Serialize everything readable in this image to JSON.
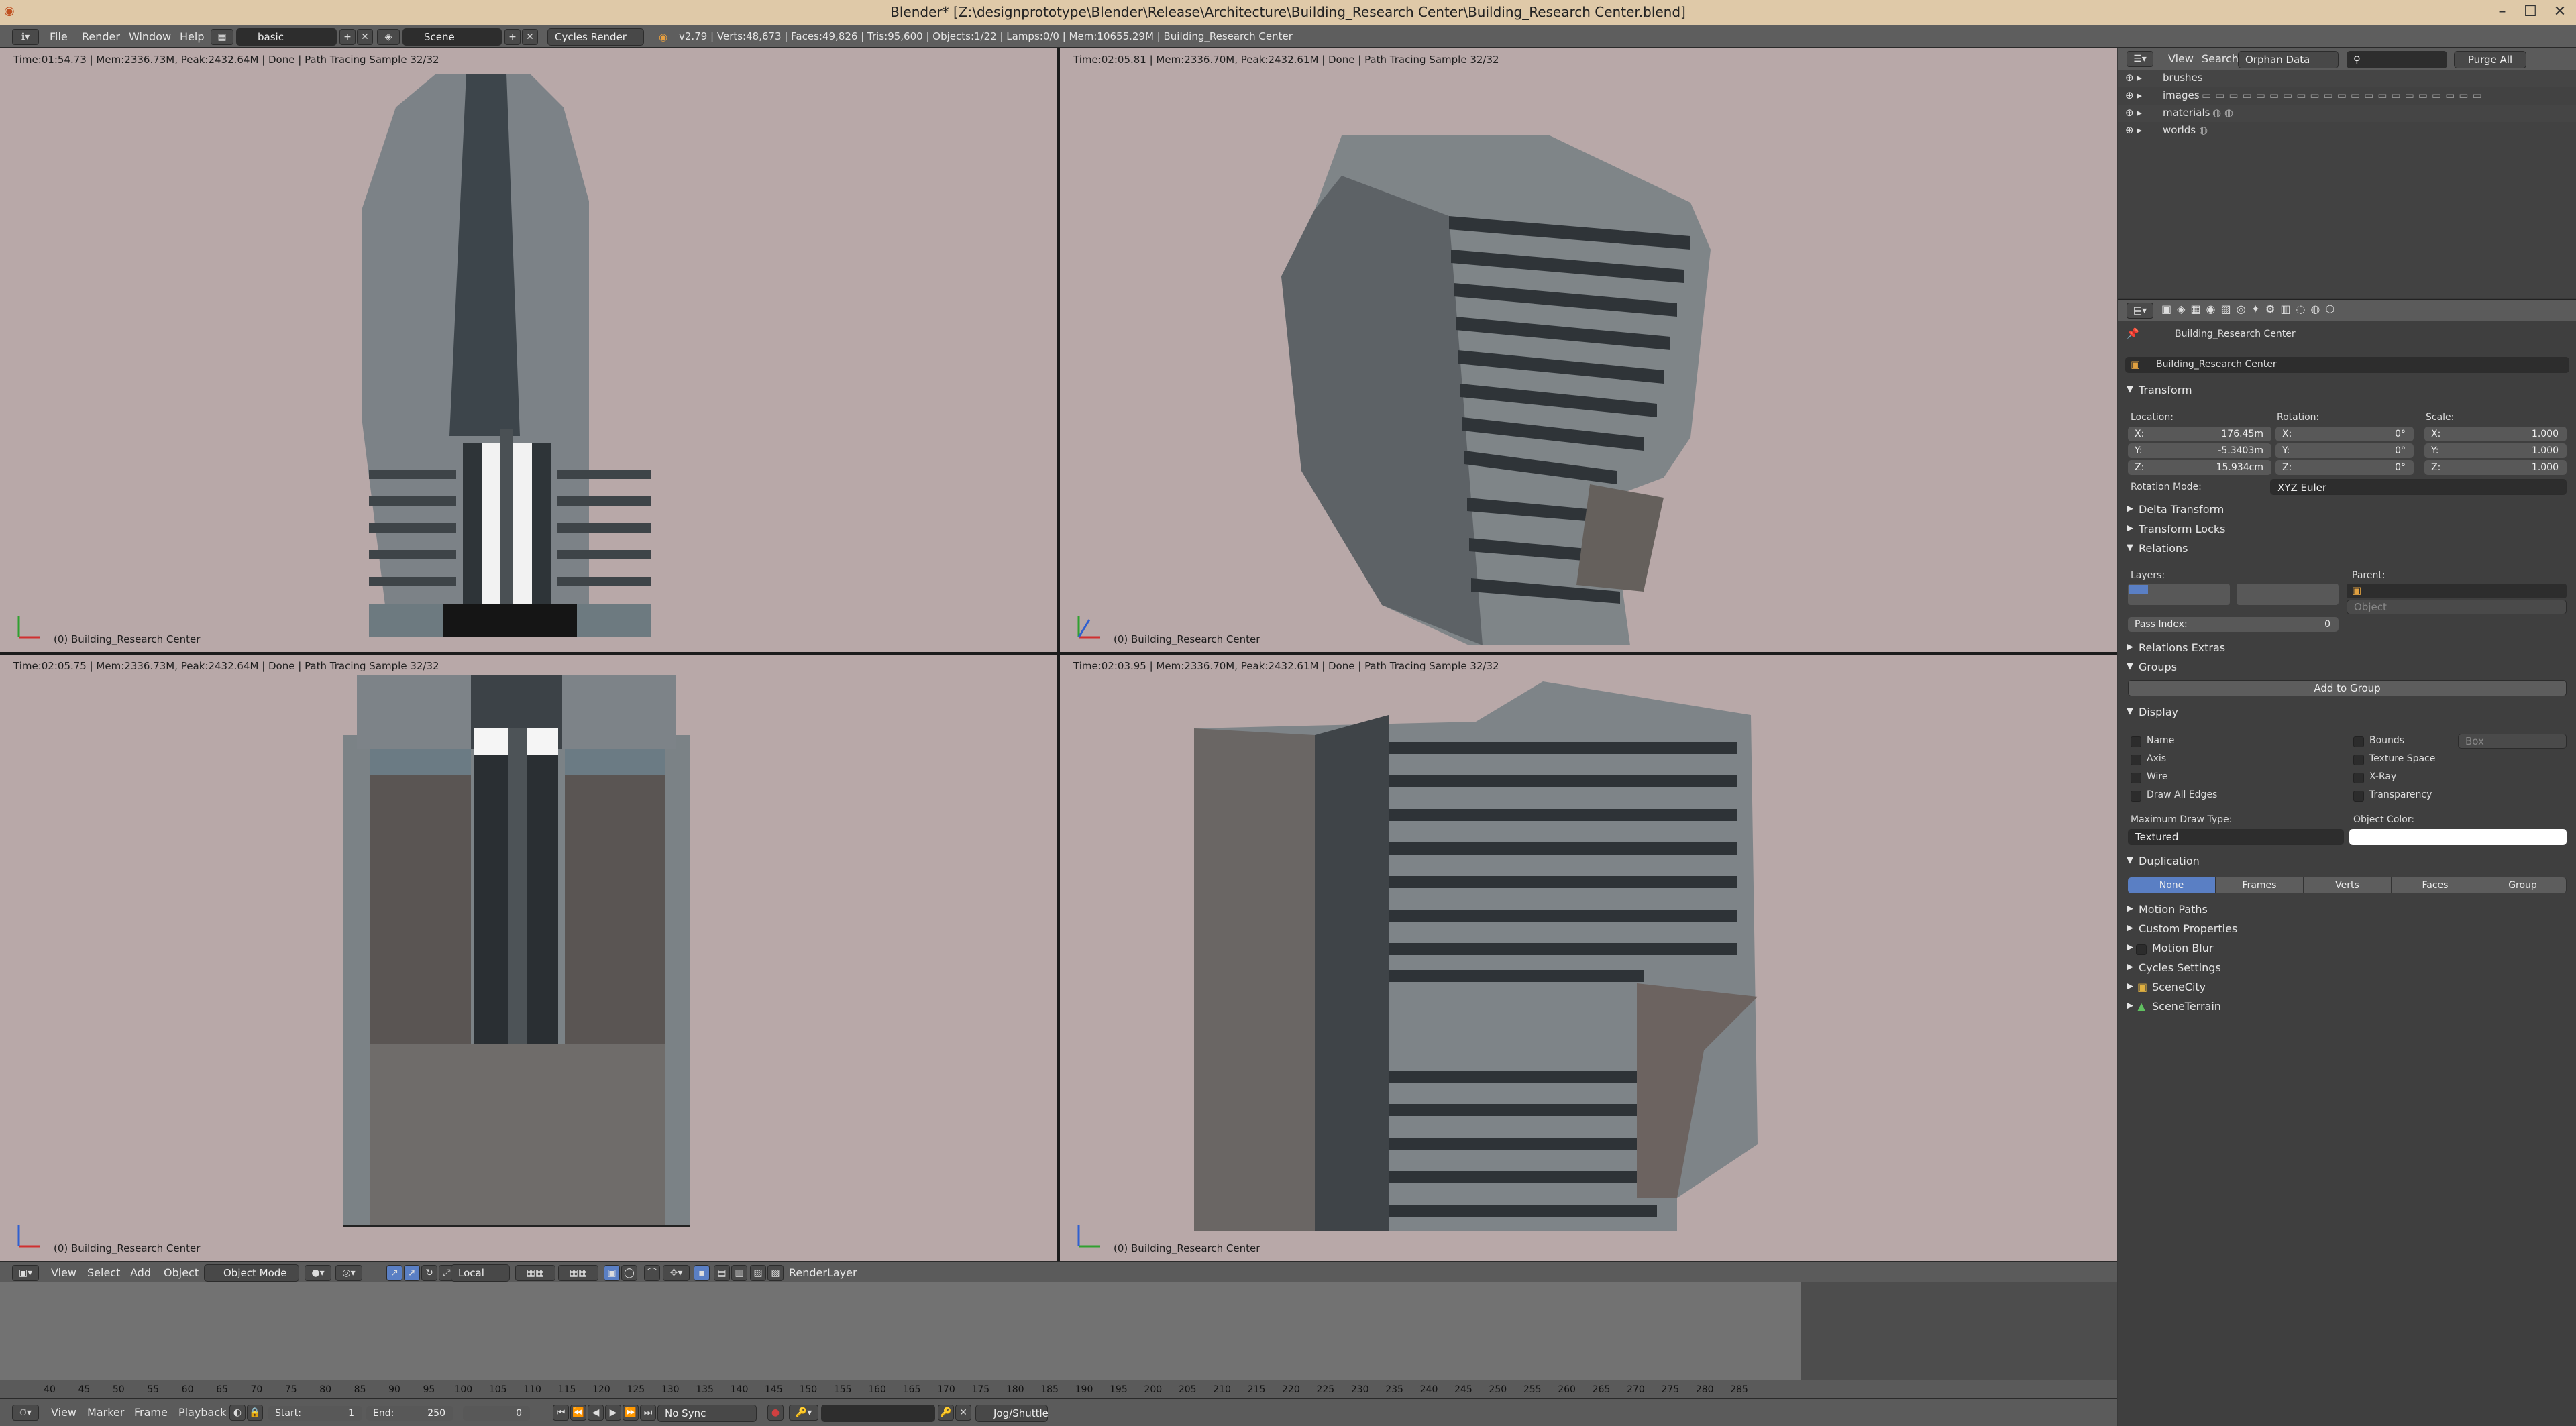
{
  "window": {
    "title": "Blender* [Z:\\designprototype\\Blender\\Release\\Architecture\\Building_Research Center\\Building_Research Center.blend]",
    "controls": [
      "–",
      "☐",
      "✕"
    ]
  },
  "info_header": {
    "menus": [
      "File",
      "Render",
      "Window",
      "Help"
    ],
    "layout": "basic",
    "scene": "Scene",
    "engine": "Cycles Render",
    "stats": "v2.79 | Verts:48,673 | Faces:49,826 | Tris:95,600 | Objects:1/22 | Lamps:0/0 | Mem:10655.29M | Building_Research Center"
  },
  "viewports": [
    {
      "stat": "Time:01:54.73 | Mem:2336.73M, Peak:2432.64M | Done | Path Tracing Sample 32/32",
      "object": "(0) Building_Research Center"
    },
    {
      "stat": "Time:02:05.81 | Mem:2336.70M, Peak:2432.61M | Done | Path Tracing Sample 32/32",
      "object": "(0) Building_Research Center"
    },
    {
      "stat": "Time:02:05.75 | Mem:2336.73M, Peak:2432.64M | Done | Path Tracing Sample 32/32",
      "object": "(0) Building_Research Center"
    },
    {
      "stat": "Time:02:03.95 | Mem:2336.70M, Peak:2432.61M | Done | Path Tracing Sample 32/32",
      "object": "(0) Building_Research Center"
    }
  ],
  "view3d_header": {
    "menus": [
      "View",
      "Select",
      "Add",
      "Object"
    ],
    "mode": "Object Mode",
    "pivot": "Local",
    "render_layer": "RenderLayer"
  },
  "timeline": {
    "ticks": [
      "40",
      "45",
      "50",
      "55",
      "60",
      "65",
      "70",
      "75",
      "80",
      "85",
      "90",
      "95",
      "100",
      "105",
      "110",
      "115",
      "120",
      "125",
      "130",
      "135",
      "140",
      "145",
      "150",
      "155",
      "160",
      "165",
      "170",
      "175",
      "180",
      "185",
      "190",
      "195",
      "200",
      "205",
      "210",
      "215",
      "220",
      "225",
      "230",
      "235",
      "240",
      "245",
      "250",
      "255",
      "260",
      "265",
      "270",
      "275",
      "280",
      "285"
    ],
    "menus": [
      "View",
      "Marker",
      "Frame",
      "Playback"
    ],
    "start_label": "Start:",
    "start": "1",
    "end_label": "End:",
    "end": "250",
    "current": "0",
    "sync": "No Sync",
    "jog": "Jog/Shuttle"
  },
  "outliner": {
    "view": "View",
    "search": "Search",
    "display_mode": "Orphan Data",
    "purge": "Purge All",
    "items": [
      "brushes",
      "images",
      "materials",
      "worlds"
    ]
  },
  "properties": {
    "breadcrumb": "Building_Research Center",
    "object_name": "Building_Research Center",
    "transform": {
      "header": "Transform",
      "location_label": "Location:",
      "rotation_label": "Rotation:",
      "scale_label": "Scale:",
      "location": [
        {
          "k": "X:",
          "v": "176.45m"
        },
        {
          "k": "Y:",
          "v": "-5.3403m"
        },
        {
          "k": "Z:",
          "v": "15.934cm"
        }
      ],
      "rotation": [
        {
          "k": "X:",
          "v": "0°"
        },
        {
          "k": "Y:",
          "v": "0°"
        },
        {
          "k": "Z:",
          "v": "0°"
        }
      ],
      "scale": [
        {
          "k": "X:",
          "v": "1.000"
        },
        {
          "k": "Y:",
          "v": "1.000"
        },
        {
          "k": "Z:",
          "v": "1.000"
        }
      ],
      "rotation_mode_label": "Rotation Mode:",
      "rotation_mode": "XYZ Euler"
    },
    "panels_collapsed_1": [
      "Delta Transform",
      "Transform Locks"
    ],
    "relations": {
      "header": "Relations",
      "layers_label": "Layers:",
      "parent_label": "Parent:",
      "parent_type": "Object",
      "pass_index_label": "Pass Index:",
      "pass_index": "0"
    },
    "relations_extras": "Relations Extras",
    "groups": {
      "header": "Groups",
      "add": "Add to Group"
    },
    "display": {
      "header": "Display",
      "left": [
        "Name",
        "Axis",
        "Wire",
        "Draw All Edges"
      ],
      "right": [
        "Bounds",
        "Texture Space",
        "X-Ray",
        "Transparency"
      ],
      "bounds_type": "Box",
      "max_draw_label": "Maximum Draw Type:",
      "max_draw": "Textured",
      "obj_color_label": "Object Color:"
    },
    "duplication": {
      "header": "Duplication",
      "options": [
        "None",
        "Frames",
        "Verts",
        "Faces",
        "Group"
      ],
      "selected": "None"
    },
    "panels_collapsed_2": [
      "Motion Paths",
      "Custom Properties",
      "Motion Blur",
      "Cycles Settings",
      "SceneCity",
      "SceneTerrain"
    ]
  }
}
